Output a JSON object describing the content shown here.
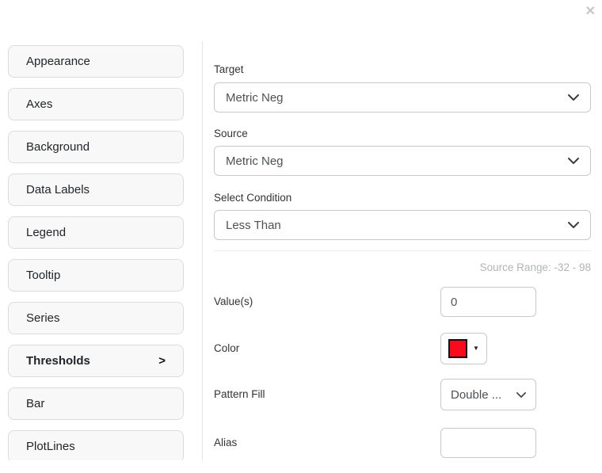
{
  "dialog": {
    "close_icon": "✕"
  },
  "sidebar": {
    "items": [
      {
        "label": "Appearance"
      },
      {
        "label": "Axes"
      },
      {
        "label": "Background"
      },
      {
        "label": "Data Labels"
      },
      {
        "label": "Legend"
      },
      {
        "label": "Tooltip"
      },
      {
        "label": "Series"
      },
      {
        "label": "Thresholds",
        "active": true,
        "arrow": ">"
      },
      {
        "label": "Bar"
      },
      {
        "label": "PlotLines"
      }
    ]
  },
  "form": {
    "target": {
      "label": "Target",
      "value": "Metric Neg"
    },
    "source": {
      "label": "Source",
      "value": "Metric Neg"
    },
    "condition": {
      "label": "Select Condition",
      "value": "Less Than"
    },
    "source_range": "Source Range: -32 - 98",
    "values": {
      "label": "Value(s)",
      "value": "0"
    },
    "color": {
      "label": "Color",
      "swatch_color": "#fb0a1e",
      "caret_icon": "▼"
    },
    "pattern_fill": {
      "label": "Pattern Fill",
      "value": "Double ..."
    },
    "alias": {
      "label": "Alias",
      "value": "",
      "placeholder": ""
    }
  }
}
